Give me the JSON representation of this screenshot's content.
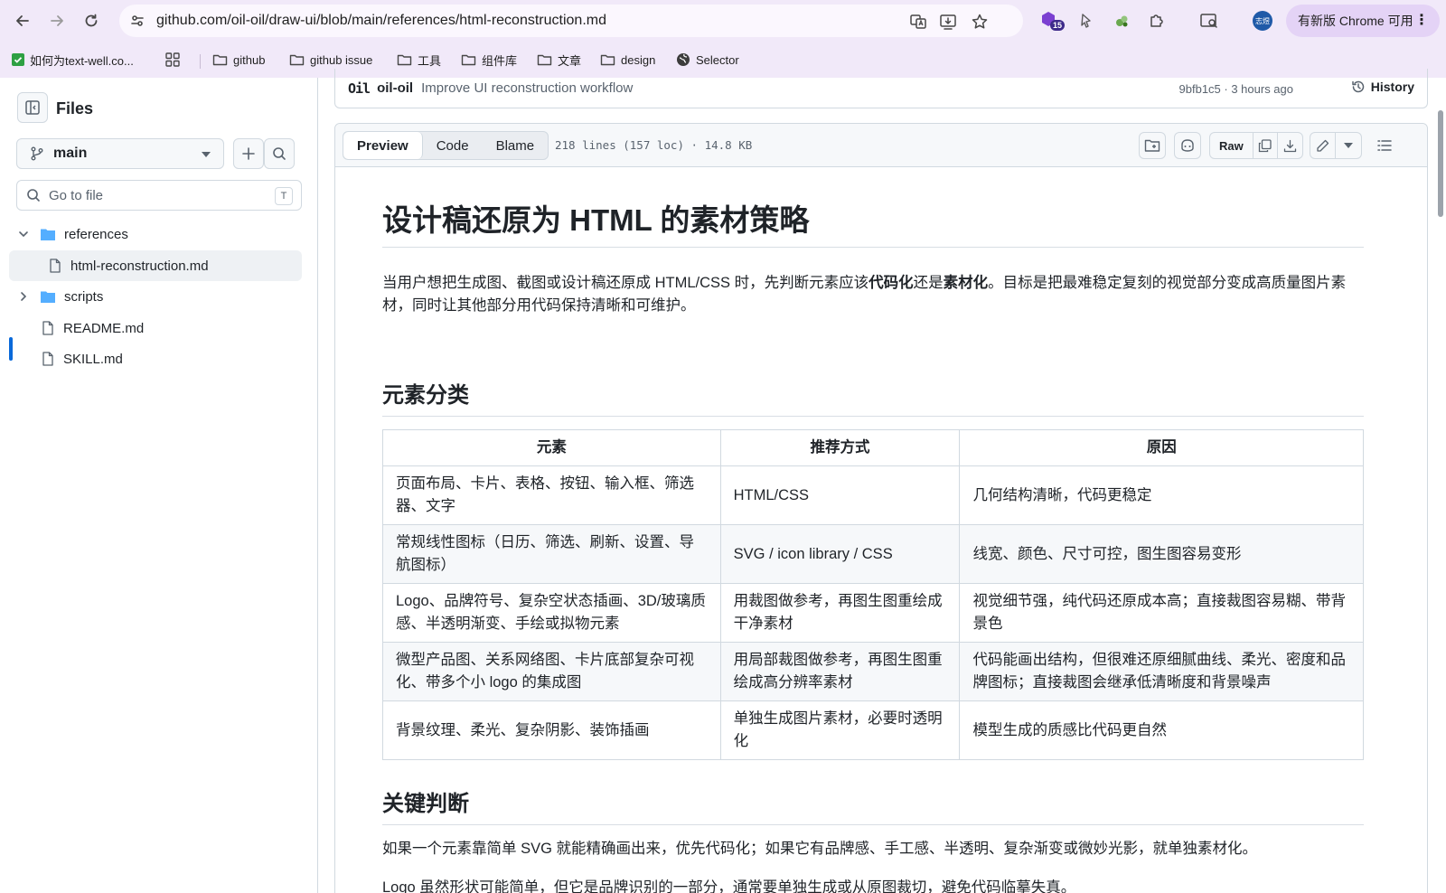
{
  "browser": {
    "url": "github.com/oil-oil/draw-ui/blob/main/references/html-reconstruction.md",
    "ext_badge": "15",
    "avatar_text": "志煜",
    "update_label": "有新版 Chrome 可用",
    "bookmarks": [
      {
        "label": "如何为text-well.co...",
        "icon": "check-favicon-icon"
      },
      {
        "label": "github",
        "icon": "folder-icon"
      },
      {
        "label": "github issue",
        "icon": "folder-icon"
      },
      {
        "label": "工具",
        "icon": "folder-icon"
      },
      {
        "label": "组件库",
        "icon": "folder-icon"
      },
      {
        "label": "文章",
        "icon": "folder-icon"
      },
      {
        "label": "design",
        "icon": "folder-icon"
      },
      {
        "label": "Selector",
        "icon": "globe-icon"
      }
    ]
  },
  "sidebar": {
    "title": "Files",
    "branch": "main",
    "goto_placeholder": "Go to file",
    "goto_shortcut": "T",
    "tree": [
      {
        "label": "references",
        "type": "folder",
        "expanded": true
      },
      {
        "label": "html-reconstruction.md",
        "type": "file",
        "active": true
      },
      {
        "label": "scripts",
        "type": "folder",
        "expanded": false
      },
      {
        "label": "README.md",
        "type": "file"
      },
      {
        "label": "SKILL.md",
        "type": "file"
      }
    ]
  },
  "commit": {
    "logo_text": "Oil",
    "author": "oil-oil",
    "message": "Improve UI reconstruction workflow",
    "sha_time": "9bfb1c5 · 3 hours ago",
    "history_label": "History"
  },
  "file": {
    "tabs": [
      "Preview",
      "Code",
      "Blame"
    ],
    "active_tab": "Preview",
    "meta": "218 lines (157 loc) · 14.8 KB",
    "raw_label": "Raw"
  },
  "doc": {
    "h1": "设计稿还原为 HTML 的素材策略",
    "intro_a": "当用户想把生成图、截图或设计稿还原成 HTML/CSS 时，先判断元素应该",
    "intro_b": "代码化",
    "intro_c": "还是",
    "intro_d": "素材化",
    "intro_e": "。目标是把最难稳定复刻的视觉部分变成高质量图片素材，同时让其他部分用代码保持清晰和可维护。",
    "h2_a": "元素分类",
    "table": {
      "headers": [
        "元素",
        "推荐方式",
        "原因"
      ],
      "rows": [
        [
          "页面布局、卡片、表格、按钮、输入框、筛选器、文字",
          "HTML/CSS",
          "几何结构清晰，代码更稳定"
        ],
        [
          "常规线性图标（日历、筛选、刷新、设置、导航图标）",
          "SVG / icon library / CSS",
          "线宽、颜色、尺寸可控，图生图容易变形"
        ],
        [
          "Logo、品牌符号、复杂空状态插画、3D/玻璃质感、半透明渐变、手绘或拟物元素",
          "用裁图做参考，再图生图重绘成干净素材",
          "视觉细节强，纯代码还原成本高；直接裁图容易糊、带背景色"
        ],
        [
          "微型产品图、关系网络图、卡片底部复杂可视化、带多个小 logo 的集成图",
          "用局部裁图做参考，再图生图重绘成高分辨率素材",
          "代码能画出结构，但很难还原细腻曲线、柔光、密度和品牌图标；直接裁图会继承低清晰度和背景噪声"
        ],
        [
          "背景纹理、柔光、复杂阴影、装饰插画",
          "单独生成图片素材，必要时透明化",
          "模型生成的质感比代码更自然"
        ]
      ]
    },
    "h2_b": "关键判断",
    "p1": "如果一个元素靠简单 SVG 就能精确画出来，优先代码化；如果它有品牌感、手工感、半透明、复杂渐变或微妙光影，就单独素材化。",
    "p2": "Logo 虽然形状可能简单，但它是品牌识别的一部分，通常要单独生成或从原图裁切，避免代码临摹失真。"
  },
  "colors": {
    "chrome_bg": "#f1e9f9",
    "accent": "#0969da",
    "border": "#d1d9e0",
    "folder": "#54aeff"
  }
}
